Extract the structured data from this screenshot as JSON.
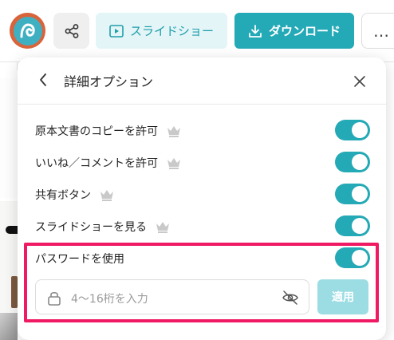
{
  "toolbar": {
    "slideshow_label": "スライドショー",
    "download_label": "ダウンロード",
    "more_label": "…"
  },
  "panel": {
    "title": "詳細オプション",
    "options": [
      {
        "label": "原本文書のコピーを許可",
        "enabled": true
      },
      {
        "label": "いいね／コメントを許可",
        "enabled": true
      },
      {
        "label": "共有ボタン",
        "enabled": true
      },
      {
        "label": "スライドショーを見る",
        "enabled": true
      },
      {
        "label": "パスワードを使用",
        "enabled": true
      }
    ],
    "password": {
      "placeholder": "4〜16桁を入力",
      "apply_label": "適用"
    }
  },
  "colors": {
    "accent": "#24a9b7",
    "accent_light": "#e3f5f7",
    "apply_disabled": "#9cdde4",
    "highlight": "#ef1a63",
    "crown": "#c9c9c9"
  }
}
